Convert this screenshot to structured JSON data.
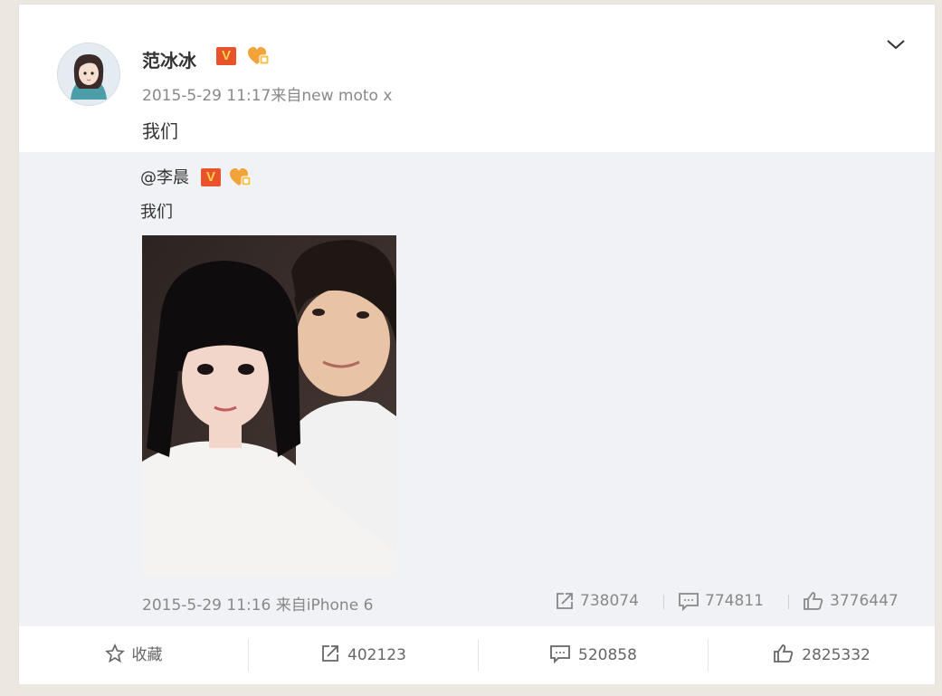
{
  "post": {
    "author": "范冰冰",
    "datetime": "2015-5-29 11:17",
    "source": "来自new moto x",
    "text": "我们"
  },
  "repost": {
    "author": "@李晨",
    "text": "我们",
    "datetime": "2015-5-29 11:16",
    "source": "来自iPhone 6",
    "repost_count": "738074",
    "comment_count": "774811",
    "like_count": "3776447"
  },
  "footer": {
    "favorite_label": "收藏",
    "repost_count": "402123",
    "comment_count": "520858",
    "like_count": "2825332"
  },
  "colors": {
    "verified_badge": "#e8532b",
    "repost_background": "#f1f2f5",
    "meta_text": "#888888"
  },
  "icons": [
    "chevron-down-icon",
    "verified-icon",
    "vip-heart-icon",
    "repost-icon",
    "comment-icon",
    "like-icon",
    "star-icon"
  ]
}
